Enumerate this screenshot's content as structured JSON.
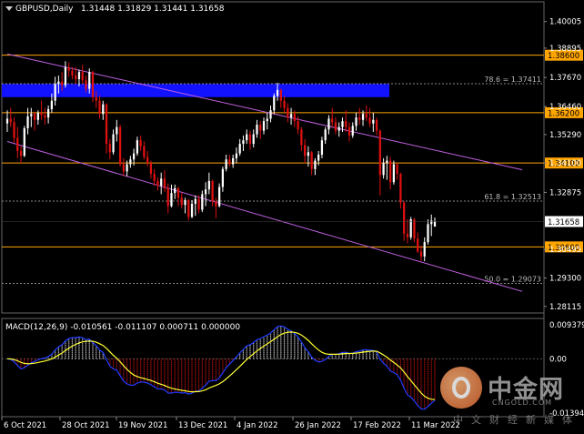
{
  "header": {
    "symbol": "GBPUSD,Daily",
    "ohlc": "1.31448 1.31829 1.31441 1.31658"
  },
  "macd_header": "MACD(12,26,9) -0.010561 -0.011107 0.000711 0.000000",
  "price_axis": {
    "ticks": [
      "1.40005",
      "1.38895",
      "1.37670",
      "1.36460",
      "1.35290",
      "1.34100",
      "1.32875",
      "1.31665",
      "1.30495",
      "1.29300",
      "1.28115"
    ],
    "current_price": "1.31658"
  },
  "macd_axis": {
    "ticks": [
      "0.009379",
      "0.00",
      "-0.013941"
    ]
  },
  "time_axis": [
    "6 Oct 2021",
    "28 Oct 2021",
    "19 Nov 2021",
    "13 Dec 2021",
    "4 Jan 2022",
    "26 Jan 2022",
    "17 Feb 2022",
    "11 Mar 2022"
  ],
  "levels": [
    {
      "price": 1.386,
      "label": "1.38600",
      "color": "#ffa500"
    },
    {
      "price": 1.362,
      "label": "1.36200",
      "color": "#ffa500"
    },
    {
      "price": 1.341,
      "label": "1.34100",
      "color": "#ffa500"
    },
    {
      "price": 1.306,
      "label": "1.30600",
      "color": "#ffa500"
    }
  ],
  "fib_levels": [
    {
      "price": 1.37411,
      "label": "78.6 = 1.37411"
    },
    {
      "price": 1.32513,
      "label": "61.8 = 1.32513"
    },
    {
      "price": 1.29073,
      "label": "50.0 = 1.29073"
    }
  ],
  "supply_zone": {
    "from": 1.3685,
    "to": 1.374,
    "color": "#1212ff"
  },
  "channel": {
    "color": "#c060e0",
    "upper": [
      {
        "date": "2021-09-24",
        "price": 1.3865
      },
      {
        "date": "2022-03-24",
        "price": 1.3452
      }
    ],
    "lower": [
      {
        "date": "2021-09-24",
        "price": 1.35
      },
      {
        "date": "2022-03-24",
        "price": 1.2965
      }
    ]
  },
  "watermark": {
    "cn": "中金网",
    "domain": "CNGOLD.COM",
    "sub": "中文财经新媒体"
  },
  "chart_data": {
    "type": "candlestick",
    "symbol": "GBPUSD",
    "timeframe": "Daily",
    "ylim": [
      1.27955,
      1.40145
    ],
    "candles": [
      {
        "date": "2021-09-24",
        "o": 1.3575,
        "h": 1.363,
        "l": 1.354,
        "c": 1.3595
      },
      {
        "date": "2021-09-27",
        "o": 1.3595,
        "h": 1.364,
        "l": 1.356,
        "c": 1.358
      },
      {
        "date": "2021-09-28",
        "o": 1.358,
        "h": 1.36,
        "l": 1.3495,
        "c": 1.3515
      },
      {
        "date": "2021-09-29",
        "o": 1.3515,
        "h": 1.356,
        "l": 1.343,
        "c": 1.346
      },
      {
        "date": "2021-09-30",
        "o": 1.346,
        "h": 1.348,
        "l": 1.341,
        "c": 1.344
      },
      {
        "date": "2021-10-01",
        "o": 1.344,
        "h": 1.3565,
        "l": 1.3435,
        "c": 1.3555
      },
      {
        "date": "2021-10-04",
        "o": 1.3555,
        "h": 1.364,
        "l": 1.353,
        "c": 1.3605
      },
      {
        "date": "2021-10-05",
        "o": 1.3605,
        "h": 1.364,
        "l": 1.356,
        "c": 1.3615
      },
      {
        "date": "2021-10-06",
        "o": 1.3615,
        "h": 1.3625,
        "l": 1.3545,
        "c": 1.359
      },
      {
        "date": "2021-10-07",
        "o": 1.359,
        "h": 1.363,
        "l": 1.357,
        "c": 1.362
      },
      {
        "date": "2021-10-08",
        "o": 1.362,
        "h": 1.367,
        "l": 1.359,
        "c": 1.361
      },
      {
        "date": "2021-10-11",
        "o": 1.361,
        "h": 1.364,
        "l": 1.357,
        "c": 1.36
      },
      {
        "date": "2021-10-12",
        "o": 1.36,
        "h": 1.365,
        "l": 1.3575,
        "c": 1.3635
      },
      {
        "date": "2021-10-13",
        "o": 1.3635,
        "h": 1.37,
        "l": 1.362,
        "c": 1.367
      },
      {
        "date": "2021-10-14",
        "o": 1.367,
        "h": 1.377,
        "l": 1.365,
        "c": 1.374
      },
      {
        "date": "2021-10-15",
        "o": 1.374,
        "h": 1.3775,
        "l": 1.37,
        "c": 1.375
      },
      {
        "date": "2021-10-18",
        "o": 1.375,
        "h": 1.379,
        "l": 1.371,
        "c": 1.3735
      },
      {
        "date": "2021-10-19",
        "o": 1.3735,
        "h": 1.3835,
        "l": 1.3725,
        "c": 1.381
      },
      {
        "date": "2021-10-20",
        "o": 1.381,
        "h": 1.383,
        "l": 1.377,
        "c": 1.3795
      },
      {
        "date": "2021-10-21",
        "o": 1.3795,
        "h": 1.381,
        "l": 1.376,
        "c": 1.3775
      },
      {
        "date": "2021-10-22",
        "o": 1.3775,
        "h": 1.381,
        "l": 1.374,
        "c": 1.376
      },
      {
        "date": "2021-10-25",
        "o": 1.376,
        "h": 1.38,
        "l": 1.373,
        "c": 1.379
      },
      {
        "date": "2021-10-26",
        "o": 1.379,
        "h": 1.382,
        "l": 1.374,
        "c": 1.3755
      },
      {
        "date": "2021-10-27",
        "o": 1.3755,
        "h": 1.3775,
        "l": 1.3705,
        "c": 1.372
      },
      {
        "date": "2021-10-28",
        "o": 1.372,
        "h": 1.3805,
        "l": 1.37,
        "c": 1.379
      },
      {
        "date": "2021-10-29",
        "o": 1.379,
        "h": 1.3795,
        "l": 1.3665,
        "c": 1.3685
      },
      {
        "date": "2021-11-01",
        "o": 1.3685,
        "h": 1.371,
        "l": 1.364,
        "c": 1.367
      },
      {
        "date": "2021-11-02",
        "o": 1.367,
        "h": 1.369,
        "l": 1.3595,
        "c": 1.3615
      },
      {
        "date": "2021-11-03",
        "o": 1.3615,
        "h": 1.367,
        "l": 1.359,
        "c": 1.3655
      },
      {
        "date": "2021-11-04",
        "o": 1.3655,
        "h": 1.366,
        "l": 1.345,
        "c": 1.349
      },
      {
        "date": "2021-11-05",
        "o": 1.349,
        "h": 1.351,
        "l": 1.3425,
        "c": 1.3455
      },
      {
        "date": "2021-11-08",
        "o": 1.3455,
        "h": 1.355,
        "l": 1.3445,
        "c": 1.353
      },
      {
        "date": "2021-11-09",
        "o": 1.353,
        "h": 1.359,
        "l": 1.35,
        "c": 1.356
      },
      {
        "date": "2021-11-10",
        "o": 1.356,
        "h": 1.357,
        "l": 1.3395,
        "c": 1.3405
      },
      {
        "date": "2021-11-11",
        "o": 1.3405,
        "h": 1.343,
        "l": 1.3355,
        "c": 1.3375
      },
      {
        "date": "2021-11-12",
        "o": 1.3375,
        "h": 1.342,
        "l": 1.3355,
        "c": 1.3405
      },
      {
        "date": "2021-11-15",
        "o": 1.3405,
        "h": 1.344,
        "l": 1.339,
        "c": 1.3425
      },
      {
        "date": "2021-11-16",
        "o": 1.3425,
        "h": 1.347,
        "l": 1.34,
        "c": 1.345
      },
      {
        "date": "2021-11-17",
        "o": 1.345,
        "h": 1.352,
        "l": 1.344,
        "c": 1.3505
      },
      {
        "date": "2021-11-18",
        "o": 1.3505,
        "h": 1.3525,
        "l": 1.346,
        "c": 1.348
      },
      {
        "date": "2021-11-19",
        "o": 1.348,
        "h": 1.35,
        "l": 1.3425,
        "c": 1.3435
      },
      {
        "date": "2021-11-22",
        "o": 1.3435,
        "h": 1.346,
        "l": 1.3395,
        "c": 1.341
      },
      {
        "date": "2021-11-23",
        "o": 1.341,
        "h": 1.342,
        "l": 1.3345,
        "c": 1.3365
      },
      {
        "date": "2021-11-24",
        "o": 1.3365,
        "h": 1.3385,
        "l": 1.3315,
        "c": 1.3335
      },
      {
        "date": "2021-11-25",
        "o": 1.3335,
        "h": 1.335,
        "l": 1.3295,
        "c": 1.3315
      },
      {
        "date": "2021-11-26",
        "o": 1.3315,
        "h": 1.337,
        "l": 1.328,
        "c": 1.3345
      },
      {
        "date": "2021-11-29",
        "o": 1.3345,
        "h": 1.338,
        "l": 1.329,
        "c": 1.3305
      },
      {
        "date": "2021-11-30",
        "o": 1.3305,
        "h": 1.3325,
        "l": 1.32,
        "c": 1.323
      },
      {
        "date": "2021-12-01",
        "o": 1.323,
        "h": 1.332,
        "l": 1.3225,
        "c": 1.3285
      },
      {
        "date": "2021-12-02",
        "o": 1.3285,
        "h": 1.332,
        "l": 1.326,
        "c": 1.3305
      },
      {
        "date": "2021-12-03",
        "o": 1.3305,
        "h": 1.331,
        "l": 1.323,
        "c": 1.3265
      },
      {
        "date": "2021-12-06",
        "o": 1.3265,
        "h": 1.3285,
        "l": 1.322,
        "c": 1.3235
      },
      {
        "date": "2021-12-07",
        "o": 1.3235,
        "h": 1.3265,
        "l": 1.32,
        "c": 1.3255
      },
      {
        "date": "2021-12-08",
        "o": 1.3255,
        "h": 1.326,
        "l": 1.317,
        "c": 1.3185
      },
      {
        "date": "2021-12-09",
        "o": 1.3185,
        "h": 1.3255,
        "l": 1.318,
        "c": 1.324
      },
      {
        "date": "2021-12-10",
        "o": 1.324,
        "h": 1.3275,
        "l": 1.319,
        "c": 1.326
      },
      {
        "date": "2021-12-13",
        "o": 1.326,
        "h": 1.3275,
        "l": 1.32,
        "c": 1.3215
      },
      {
        "date": "2021-12-14",
        "o": 1.3215,
        "h": 1.3295,
        "l": 1.3205,
        "c": 1.328
      },
      {
        "date": "2021-12-15",
        "o": 1.328,
        "h": 1.333,
        "l": 1.323,
        "c": 1.33
      },
      {
        "date": "2021-12-16",
        "o": 1.33,
        "h": 1.337,
        "l": 1.328,
        "c": 1.3335
      },
      {
        "date": "2021-12-17",
        "o": 1.3335,
        "h": 1.334,
        "l": 1.323,
        "c": 1.325
      },
      {
        "date": "2021-12-20",
        "o": 1.325,
        "h": 1.3265,
        "l": 1.318,
        "c": 1.323
      },
      {
        "date": "2021-12-21",
        "o": 1.323,
        "h": 1.3325,
        "l": 1.3225,
        "c": 1.331
      },
      {
        "date": "2021-12-22",
        "o": 1.331,
        "h": 1.3395,
        "l": 1.329,
        "c": 1.3385
      },
      {
        "date": "2021-12-23",
        "o": 1.3385,
        "h": 1.3445,
        "l": 1.3375,
        "c": 1.3425
      },
      {
        "date": "2021-12-24",
        "o": 1.3425,
        "h": 1.3445,
        "l": 1.3395,
        "c": 1.3405
      },
      {
        "date": "2021-12-27",
        "o": 1.3405,
        "h": 1.3445,
        "l": 1.339,
        "c": 1.343
      },
      {
        "date": "2021-12-28",
        "o": 1.343,
        "h": 1.3475,
        "l": 1.341,
        "c": 1.345
      },
      {
        "date": "2021-12-29",
        "o": 1.345,
        "h": 1.351,
        "l": 1.344,
        "c": 1.349
      },
      {
        "date": "2021-12-30",
        "o": 1.349,
        "h": 1.3525,
        "l": 1.346,
        "c": 1.3505
      },
      {
        "date": "2021-12-31",
        "o": 1.3505,
        "h": 1.355,
        "l": 1.349,
        "c": 1.353
      },
      {
        "date": "2022-01-03",
        "o": 1.353,
        "h": 1.3545,
        "l": 1.3465,
        "c": 1.349
      },
      {
        "date": "2022-01-04",
        "o": 1.349,
        "h": 1.355,
        "l": 1.3475,
        "c": 1.353
      },
      {
        "date": "2022-01-05",
        "o": 1.353,
        "h": 1.359,
        "l": 1.3515,
        "c": 1.357
      },
      {
        "date": "2022-01-06",
        "o": 1.357,
        "h": 1.3585,
        "l": 1.351,
        "c": 1.3545
      },
      {
        "date": "2022-01-07",
        "o": 1.3545,
        "h": 1.36,
        "l": 1.353,
        "c": 1.3585
      },
      {
        "date": "2022-01-10",
        "o": 1.3585,
        "h": 1.362,
        "l": 1.355,
        "c": 1.3595
      },
      {
        "date": "2022-01-11",
        "o": 1.3595,
        "h": 1.365,
        "l": 1.358,
        "c": 1.363
      },
      {
        "date": "2022-01-12",
        "o": 1.363,
        "h": 1.37,
        "l": 1.3615,
        "c": 1.369
      },
      {
        "date": "2022-01-13",
        "o": 1.369,
        "h": 1.3745,
        "l": 1.367,
        "c": 1.3715
      },
      {
        "date": "2022-01-14",
        "o": 1.3715,
        "h": 1.372,
        "l": 1.364,
        "c": 1.367
      },
      {
        "date": "2022-01-17",
        "o": 1.367,
        "h": 1.369,
        "l": 1.362,
        "c": 1.364
      },
      {
        "date": "2022-01-18",
        "o": 1.364,
        "h": 1.366,
        "l": 1.358,
        "c": 1.36
      },
      {
        "date": "2022-01-19",
        "o": 1.36,
        "h": 1.364,
        "l": 1.357,
        "c": 1.3615
      },
      {
        "date": "2022-01-20",
        "o": 1.3615,
        "h": 1.363,
        "l": 1.356,
        "c": 1.3585
      },
      {
        "date": "2022-01-21",
        "o": 1.3585,
        "h": 1.3605,
        "l": 1.353,
        "c": 1.355
      },
      {
        "date": "2022-01-24",
        "o": 1.355,
        "h": 1.356,
        "l": 1.346,
        "c": 1.3485
      },
      {
        "date": "2022-01-25",
        "o": 1.3485,
        "h": 1.351,
        "l": 1.341,
        "c": 1.344
      },
      {
        "date": "2022-01-26",
        "o": 1.344,
        "h": 1.348,
        "l": 1.3395,
        "c": 1.3455
      },
      {
        "date": "2022-01-27",
        "o": 1.3455,
        "h": 1.346,
        "l": 1.336,
        "c": 1.3385
      },
      {
        "date": "2022-01-28",
        "o": 1.3385,
        "h": 1.343,
        "l": 1.336,
        "c": 1.342
      },
      {
        "date": "2022-01-31",
        "o": 1.342,
        "h": 1.346,
        "l": 1.34,
        "c": 1.3445
      },
      {
        "date": "2022-02-01",
        "o": 1.3445,
        "h": 1.352,
        "l": 1.343,
        "c": 1.3505
      },
      {
        "date": "2022-02-02",
        "o": 1.3505,
        "h": 1.356,
        "l": 1.349,
        "c": 1.355
      },
      {
        "date": "2022-02-03",
        "o": 1.355,
        "h": 1.361,
        "l": 1.353,
        "c": 1.3595
      },
      {
        "date": "2022-02-04",
        "o": 1.3595,
        "h": 1.364,
        "l": 1.356,
        "c": 1.358
      },
      {
        "date": "2022-02-07",
        "o": 1.358,
        "h": 1.36,
        "l": 1.353,
        "c": 1.3545
      },
      {
        "date": "2022-02-08",
        "o": 1.3545,
        "h": 1.358,
        "l": 1.352,
        "c": 1.356
      },
      {
        "date": "2022-02-09",
        "o": 1.356,
        "h": 1.36,
        "l": 1.354,
        "c": 1.3585
      },
      {
        "date": "2022-02-10",
        "o": 1.3585,
        "h": 1.363,
        "l": 1.354,
        "c": 1.356
      },
      {
        "date": "2022-02-11",
        "o": 1.356,
        "h": 1.358,
        "l": 1.35,
        "c": 1.3525
      },
      {
        "date": "2022-02-14",
        "o": 1.3525,
        "h": 1.358,
        "l": 1.3515,
        "c": 1.3565
      },
      {
        "date": "2022-02-15",
        "o": 1.3565,
        "h": 1.362,
        "l": 1.3545,
        "c": 1.36
      },
      {
        "date": "2022-02-16",
        "o": 1.36,
        "h": 1.364,
        "l": 1.357,
        "c": 1.359
      },
      {
        "date": "2022-02-17",
        "o": 1.359,
        "h": 1.363,
        "l": 1.3565,
        "c": 1.3615
      },
      {
        "date": "2022-02-18",
        "o": 1.3615,
        "h": 1.365,
        "l": 1.3585,
        "c": 1.36
      },
      {
        "date": "2022-02-21",
        "o": 1.36,
        "h": 1.364,
        "l": 1.356,
        "c": 1.3575
      },
      {
        "date": "2022-02-22",
        "o": 1.3575,
        "h": 1.362,
        "l": 1.354,
        "c": 1.359
      },
      {
        "date": "2022-02-23",
        "o": 1.359,
        "h": 1.36,
        "l": 1.3525,
        "c": 1.3545
      },
      {
        "date": "2022-02-24",
        "o": 1.3545,
        "h": 1.355,
        "l": 1.3275,
        "c": 1.336
      },
      {
        "date": "2022-02-25",
        "o": 1.336,
        "h": 1.343,
        "l": 1.3345,
        "c": 1.341
      },
      {
        "date": "2022-02-28",
        "o": 1.341,
        "h": 1.344,
        "l": 1.334,
        "c": 1.342
      },
      {
        "date": "2022-03-01",
        "o": 1.342,
        "h": 1.3435,
        "l": 1.33,
        "c": 1.333
      },
      {
        "date": "2022-03-02",
        "o": 1.333,
        "h": 1.342,
        "l": 1.332,
        "c": 1.3405
      },
      {
        "date": "2022-03-03",
        "o": 1.3405,
        "h": 1.341,
        "l": 1.334,
        "c": 1.3365
      },
      {
        "date": "2022-03-04",
        "o": 1.3365,
        "h": 1.337,
        "l": 1.322,
        "c": 1.3245
      },
      {
        "date": "2022-03-07",
        "o": 1.3245,
        "h": 1.325,
        "l": 1.3085,
        "c": 1.3115
      },
      {
        "date": "2022-03-08",
        "o": 1.3115,
        "h": 1.3175,
        "l": 1.3075,
        "c": 1.31
      },
      {
        "date": "2022-03-09",
        "o": 1.31,
        "h": 1.3185,
        "l": 1.309,
        "c": 1.3175
      },
      {
        "date": "2022-03-10",
        "o": 1.3175,
        "h": 1.318,
        "l": 1.308,
        "c": 1.3095
      },
      {
        "date": "2022-03-11",
        "o": 1.3095,
        "h": 1.312,
        "l": 1.3035,
        "c": 1.304
      },
      {
        "date": "2022-03-14",
        "o": 1.304,
        "h": 1.3065,
        "l": 1.3,
        "c": 1.302
      },
      {
        "date": "2022-03-15",
        "o": 1.302,
        "h": 1.31,
        "l": 1.3,
        "c": 1.308
      },
      {
        "date": "2022-03-16",
        "o": 1.308,
        "h": 1.3175,
        "l": 1.307,
        "c": 1.3155
      },
      {
        "date": "2022-03-17",
        "o": 1.3155,
        "h": 1.3195,
        "l": 1.3105,
        "c": 1.317
      },
      {
        "date": "2022-03-18",
        "o": 1.3145,
        "h": 1.3183,
        "l": 1.3144,
        "c": 1.31658
      }
    ],
    "macd": {
      "name": "MACD(12,26,9)",
      "values": {
        "main": -0.010561,
        "signal": -0.011107,
        "osma": 0.000711,
        "extra": 0.0
      },
      "ylim": [
        -0.013941,
        0.009379
      ]
    },
    "xticks": [
      "6 Oct 2021",
      "28 Oct 2021",
      "19 Nov 2021",
      "13 Dec 2021",
      "4 Jan 2022",
      "26 Jan 2022",
      "17 Feb 2022",
      "11 Mar 2022"
    ]
  }
}
